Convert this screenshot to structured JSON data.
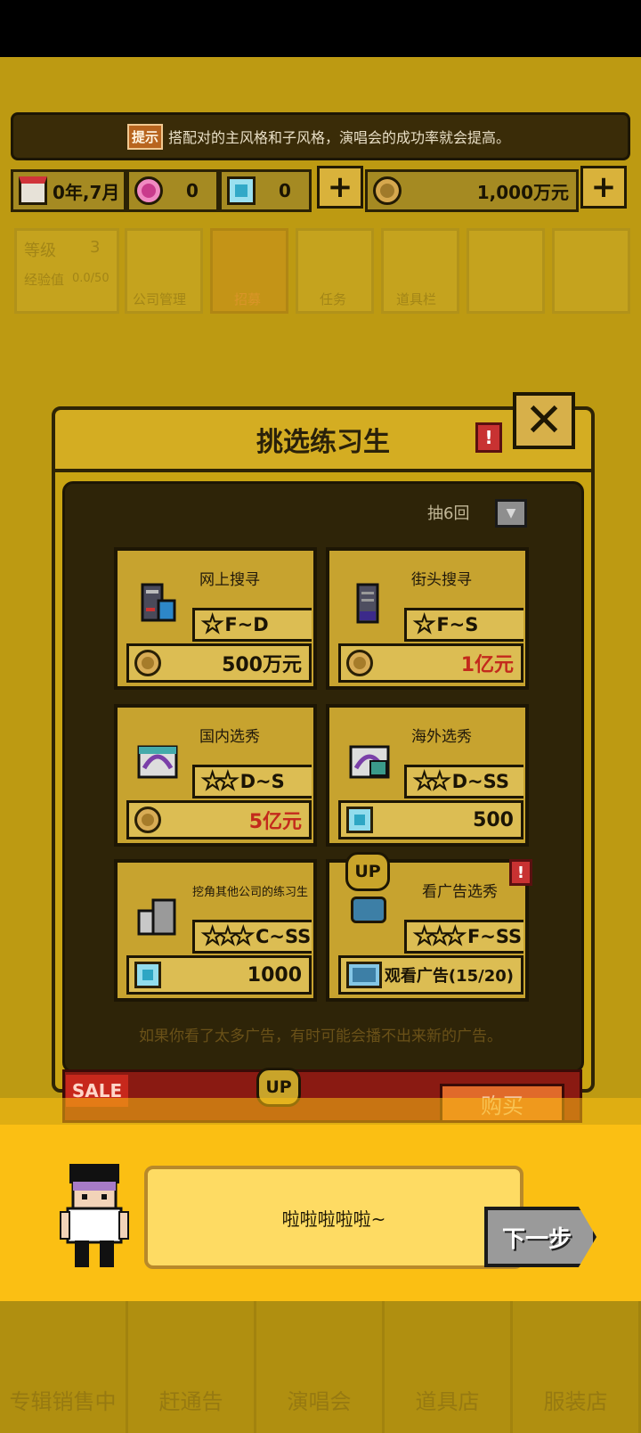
{
  "hint": {
    "badge": "提示",
    "text": "搭配对的主风格和子风格，演唱会的成功率就会提高。"
  },
  "resources": {
    "date": "0年,7月",
    "pink_gems": "0",
    "blue_gems": "0",
    "money": "1,000万元",
    "plus": "+"
  },
  "background": {
    "level_label": "等级",
    "level_value": "3",
    "exp_label": "经验值",
    "exp_value": "0.0/50",
    "menu": [
      "公司管理",
      "招募",
      "任务",
      "道具栏"
    ]
  },
  "modal": {
    "title": "挑选练习生",
    "info": "!",
    "close": "✕",
    "draw_count": "抽6回",
    "cards": [
      {
        "title": "网上搜寻",
        "rank": "F~D",
        "stars": "★",
        "cost_icon": "coin-icon",
        "cost": "500万元",
        "red": false
      },
      {
        "title": "街头搜寻",
        "rank": "F~S",
        "stars": "★",
        "cost_icon": "coin-icon",
        "cost": "1亿元",
        "red": true
      },
      {
        "title": "国内选秀",
        "rank": "D~S",
        "stars": "★★",
        "cost_icon": "coin-icon",
        "cost": "5亿元",
        "red": true
      },
      {
        "title": "海外选秀",
        "rank": "D~SS",
        "stars": "★★",
        "cost_icon": "gem-icon",
        "cost": "500",
        "red": false
      },
      {
        "title": "挖角其他公司的练习生",
        "rank": "C~SS",
        "stars": "★★★",
        "cost_icon": "gem-icon",
        "cost": "1000",
        "red": false
      },
      {
        "title": "看广告选秀",
        "rank": "F~SS",
        "stars": "★★★",
        "cost_icon": "ad-icon",
        "cost": "观看广告(15/20)",
        "red": false
      }
    ],
    "up_badge": "UP",
    "ad_alert": "!",
    "footnote": "如果你看了太多广告，有时可能会播不出来新的广告。",
    "sale_badge": "SALE",
    "buy_label": "购买"
  },
  "dialog": {
    "text": "啦啦啦啦啦~",
    "next": "下一步"
  },
  "bottom_nav": [
    "专辑销售中",
    "赶通告",
    "演唱会",
    "道具店",
    "服装店"
  ]
}
